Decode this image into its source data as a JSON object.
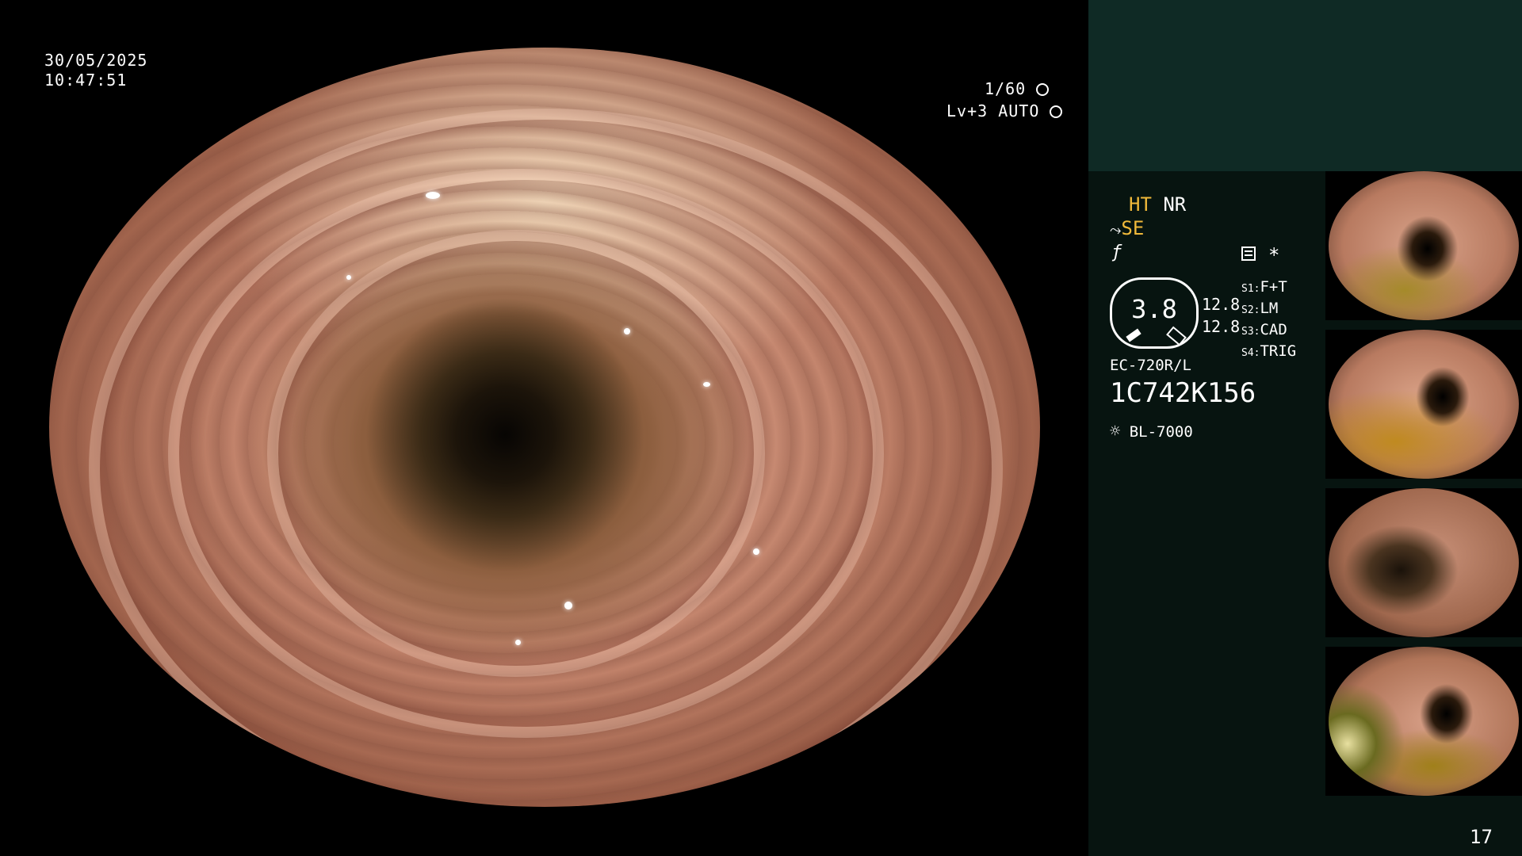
{
  "overlay": {
    "date": "30/05/2025",
    "time": "10:47:51",
    "shutter": "1/60",
    "level_auto": "Lv+3 AUTO"
  },
  "panel": {
    "mode_ht": "HT",
    "mode_nr": "NR",
    "mode_se": "SE",
    "zoom_value": "3.8",
    "zoom_r1": "12.8",
    "zoom_r2": "12.8",
    "switches": [
      {
        "key": "S1:",
        "val": "F+T"
      },
      {
        "key": "S2:",
        "val": "LM"
      },
      {
        "key": "S3:",
        "val": "CAD"
      },
      {
        "key": "S4:",
        "val": "TRIG"
      }
    ],
    "scope_model": "EC-720R/L",
    "scope_serial": "1C742K156",
    "light_source": "BL-7000",
    "asterisk": "*",
    "page_number": "17"
  },
  "icons": {
    "shutter": "aperture-icon",
    "auto": "auto-iris-icon",
    "se": "structure-enhance-icon",
    "f": "function-icon",
    "doc": "document-list-icon",
    "lamp": "lamp-icon"
  },
  "colors": {
    "panel_bg": "#071410",
    "panel_top": "#0f2a25",
    "accent": "#f0b93a"
  }
}
